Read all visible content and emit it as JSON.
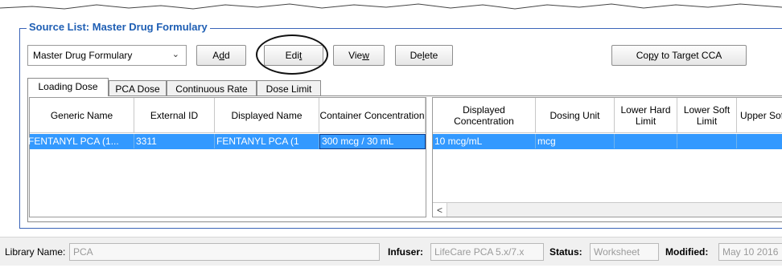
{
  "group": {
    "title": "Source List: Master Drug Formulary"
  },
  "toolbar": {
    "list_select": "Master Drug Formulary",
    "add_pre": "A",
    "add_u": "d",
    "add_post": "d",
    "edit_pre": "Edi",
    "edit_u": "t",
    "edit_post": "",
    "view_pre": "Vie",
    "view_u": "w",
    "view_post": "",
    "delete_pre": "De",
    "delete_u": "l",
    "delete_post": "ete",
    "copy_pre": "Co",
    "copy_u": "p",
    "copy_post": "y to Target CCA"
  },
  "tabs": [
    "Loading Dose",
    "PCA Dose",
    "Continuous Rate",
    "Dose Limit"
  ],
  "left_table": {
    "headers": [
      "Generic Name",
      "External ID",
      "Displayed Name",
      "Container Concentration"
    ],
    "rows": [
      [
        "FENTANYL PCA (1...",
        "3311",
        "FENTANYL PCA (1",
        "300 mcg / 30 mL"
      ]
    ]
  },
  "right_table": {
    "headers": [
      "Displayed Concentration",
      "Dosing Unit",
      "Lower Hard Limit",
      "Lower Soft Limit",
      "Upper Soft Limi"
    ],
    "rows": [
      [
        "10 mcg/mL",
        "mcg",
        "",
        "",
        ""
      ]
    ],
    "scroll_left_glyph": "<"
  },
  "status_bar": {
    "library_label": "Library Name:",
    "library_value": "PCA",
    "infuser_label": "Infuser:",
    "infuser_value": "LifeCare PCA 5.x/7.x",
    "status_label": "Status:",
    "status_value": "Worksheet",
    "modified_label": "Modified:",
    "modified_value": "May 10 2016"
  },
  "colors": {
    "title_blue": "#1f5fb4",
    "frame_blue": "#3a64b8",
    "selection": "#3399ff"
  }
}
